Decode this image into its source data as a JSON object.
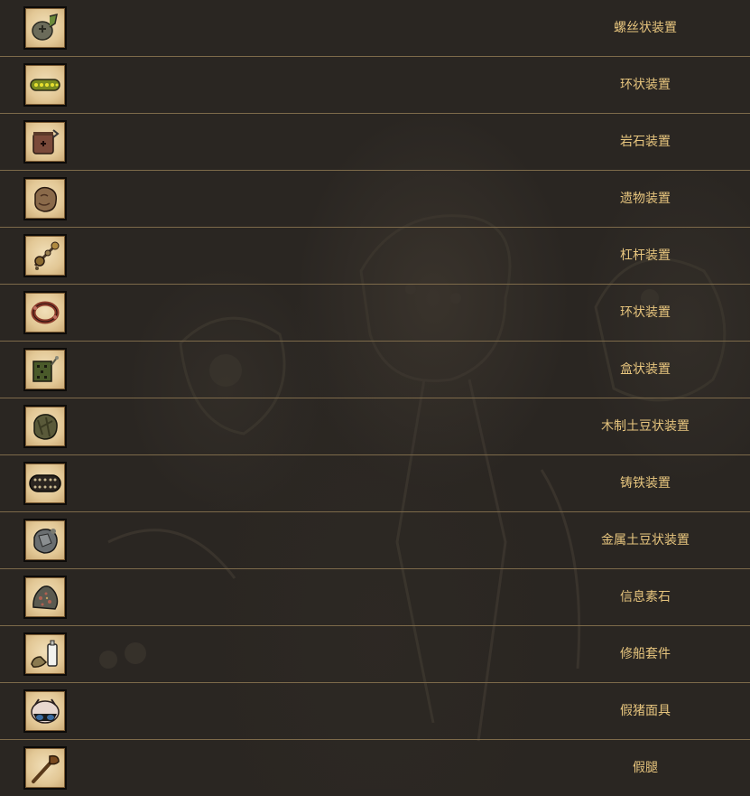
{
  "items": [
    {
      "label": "螺丝状装置",
      "icon": "spring-gadget-icon"
    },
    {
      "label": "环状装置",
      "icon": "green-ring-gadget-icon"
    },
    {
      "label": "岩石装置",
      "icon": "rock-gadget-icon"
    },
    {
      "label": "遗物装置",
      "icon": "relic-gadget-icon"
    },
    {
      "label": "杠杆装置",
      "icon": "lever-gadget-icon"
    },
    {
      "label": "环状装置",
      "icon": "red-ring-gadget-icon"
    },
    {
      "label": "盒状装置",
      "icon": "box-gadget-icon"
    },
    {
      "label": "木制土豆状装置",
      "icon": "wooden-potato-gadget-icon"
    },
    {
      "label": "铸铁装置",
      "icon": "iron-band-gadget-icon"
    },
    {
      "label": "金属土豆状装置",
      "icon": "metal-potato-gadget-icon"
    },
    {
      "label": "信息素石",
      "icon": "pheromone-stone-icon"
    },
    {
      "label": "修船套件",
      "icon": "boat-repair-kit-icon"
    },
    {
      "label": "假猪面具",
      "icon": "pig-mask-icon"
    },
    {
      "label": "假腿",
      "icon": "peg-leg-icon"
    }
  ],
  "colors": {
    "background": "#2a2622",
    "divider": "#7d6a4a",
    "label": "#e7c57e",
    "icon_bg": "#e2c795"
  }
}
